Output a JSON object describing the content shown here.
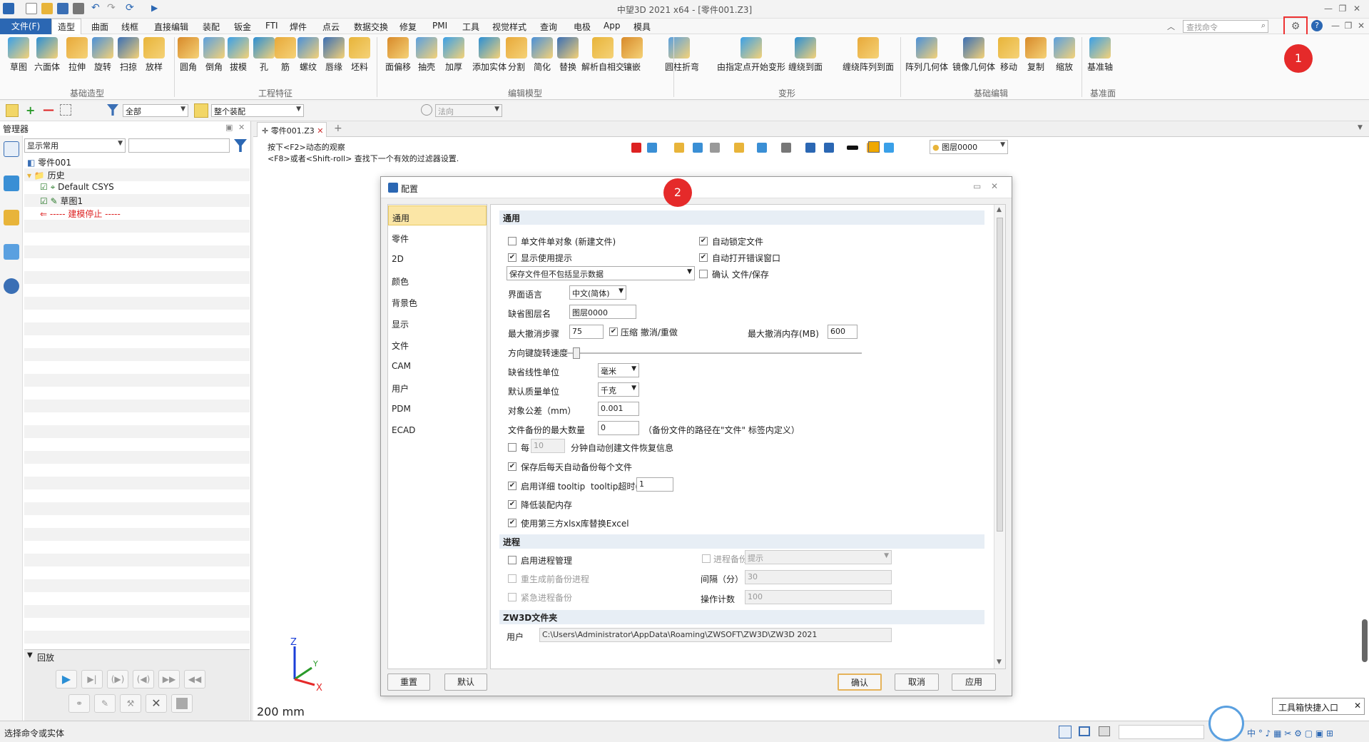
{
  "title": "中望3D 2021 x64 - [零件001.Z3]",
  "file_menu": "文件(F)",
  "menu_tabs": [
    "造型",
    "曲面",
    "线框",
    "直接编辑",
    "装配",
    "钣金",
    "FTI",
    "焊件",
    "点云",
    "数据交换",
    "修复",
    "PMI",
    "工具",
    "视觉样式",
    "查询",
    "电极",
    "App",
    "模具"
  ],
  "active_tab": "造型",
  "search_placeholder": "查找命令",
  "ribbon_groups": [
    "基础造型",
    "工程特征",
    "编辑模型",
    "变形",
    "基础编辑",
    "基准面"
  ],
  "tools": [
    "草图",
    "六面体",
    "拉伸",
    "旋转",
    "扫掠",
    "放样",
    "圆角",
    "倒角",
    "拔模",
    "孔",
    "筋",
    "螺纹",
    "唇缘",
    "坯料",
    "面偏移",
    "抽壳",
    "加厚",
    "添加实体",
    "分割",
    "简化",
    "替换",
    "解析自相交",
    "镶嵌",
    "圆柱折弯",
    "由指定点开始变形",
    "缠绕到面",
    "缠绕阵列到面",
    "阵列几何体",
    "镜像几何体",
    "移动",
    "复制",
    "缩放",
    "基准轴"
  ],
  "toolbar2": {
    "filter_all": "全部",
    "assembly": "整个装配",
    "normal": "法向"
  },
  "manager": {
    "title": "管理器",
    "filter": "显示常用",
    "items": [
      "零件001",
      "历史",
      "Default CSYS",
      "草图1",
      "----- 建模停止 -----"
    ]
  },
  "playback_title": "回放",
  "doc_tab": "零件001.Z3",
  "hint_line1": "按下<F2>动态的观察",
  "hint_line2": "<F8>或者<Shift-roll> 查找下一个有效的过滤器设置.",
  "layer": "图层0000",
  "scale_label": "200 mm",
  "status_text": "选择命令或实体",
  "callout1": "1",
  "callout2": "2",
  "toolbox_tip": "工具箱快捷入口",
  "dialog": {
    "title": "配置",
    "categories": [
      "通用",
      "零件",
      "2D",
      "颜色",
      "背景色",
      "显示",
      "文件",
      "CAM",
      "用户",
      "PDM",
      "ECAD"
    ],
    "selected_category": "通用",
    "section_general": "通用",
    "single_file": "单文件单对象 (新建文件)",
    "show_tips": "显示使用提示",
    "auto_lock": "自动锁定文件",
    "auto_error": "自动打开错误窗口",
    "save_option": "保存文件但不包括显示数据",
    "confirm_save": "确认 文件/保存",
    "lang_label": "界面语言",
    "lang_value": "中文(简体)",
    "layer_label": "缺省图层名",
    "layer_value": "图层0000",
    "undo_label": "最大撤消步骤",
    "undo_value": "75",
    "compress_undo": "压缩 撤消/重做",
    "undo_mem_label": "最大撤消内存(MB)",
    "undo_mem_value": "600",
    "arrow_speed": "方向键旋转速度",
    "linear_label": "缺省线性单位",
    "linear_value": "毫米",
    "mass_label": "默认质量单位",
    "mass_value": "千克",
    "tol_label": "对象公差（mm）",
    "tol_value": "0.001",
    "backup_label": "文件备份的最大数量",
    "backup_value": "0",
    "backup_note": "（备份文件的路径在\"文件\" 标签内定义）",
    "every": "每",
    "every_value": "10",
    "every_suffix": "分钟自动创建文件恢复信息",
    "daily_backup": "保存后每天自动备份每个文件",
    "detail_tooltip": "启用详细 tooltip",
    "tooltip_timeout_label": "tooltip超时(秒)",
    "tooltip_timeout_value": "1",
    "reduce_mem": "降低装配内存",
    "use_xlsx": "使用第三方xlsx库替换Excel",
    "section_process": "进程",
    "enable_process": "启用进程管理",
    "process_backup": "进程备份",
    "process_backup_value": "提示",
    "regen_backup": "重生成前备份进程",
    "interval_label": "间隔（分）",
    "interval_value": "30",
    "emergency_backup": "紧急进程备份",
    "op_count_label": "操作计数",
    "op_count_value": "100",
    "section_folder": "ZW3D文件夹",
    "user_label": "用户",
    "user_path": "C:\\Users\\Administrator\\AppData\\Roaming\\ZWSOFT\\ZW3D\\ZW3D 2021",
    "btn_reset": "重置",
    "btn_default": "默认",
    "btn_ok": "确认",
    "btn_cancel": "取消",
    "btn_apply": "应用"
  },
  "colors": {
    "accent": "#2b67b3",
    "callout": "#e52a2a",
    "selected": "#fbe6a6"
  }
}
